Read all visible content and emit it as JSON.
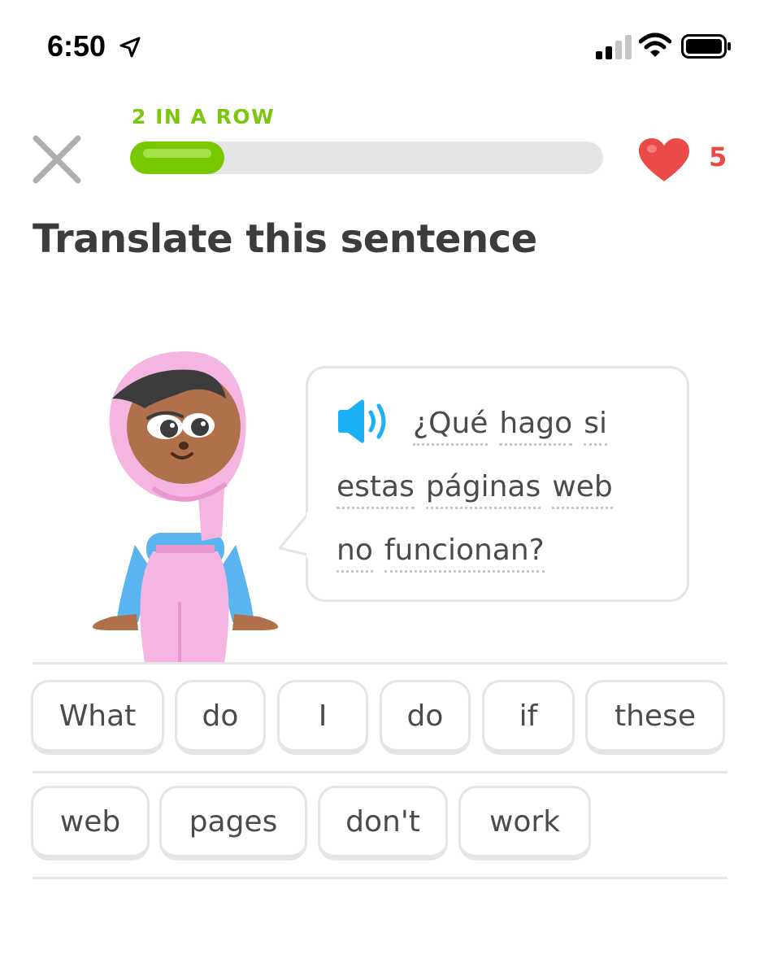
{
  "status_bar": {
    "time": "6:50",
    "icons": [
      "location-arrow-icon",
      "cellular-signal-icon",
      "wifi-icon",
      "battery-icon"
    ]
  },
  "header": {
    "streak_label": "2 IN A ROW",
    "progress_fraction": 0.2,
    "hearts": "5"
  },
  "title": "Translate this sentence",
  "prompt": {
    "lines": [
      [
        "¿Qué",
        "hago",
        "si"
      ],
      [
        "estas",
        "páginas",
        "web"
      ],
      [
        "no",
        "funcionan?"
      ]
    ]
  },
  "word_bank": {
    "row1": [
      "What",
      "do",
      "I",
      "do",
      "if",
      "these"
    ],
    "row2": [
      "web",
      "pages",
      "don't",
      "work"
    ]
  },
  "colors": {
    "green": "#78c800",
    "streak_green": "#7ac70c",
    "heart_red": "#ea4b48",
    "speaker_blue": "#1cb0f6",
    "border_gray": "#e5e5e5"
  }
}
